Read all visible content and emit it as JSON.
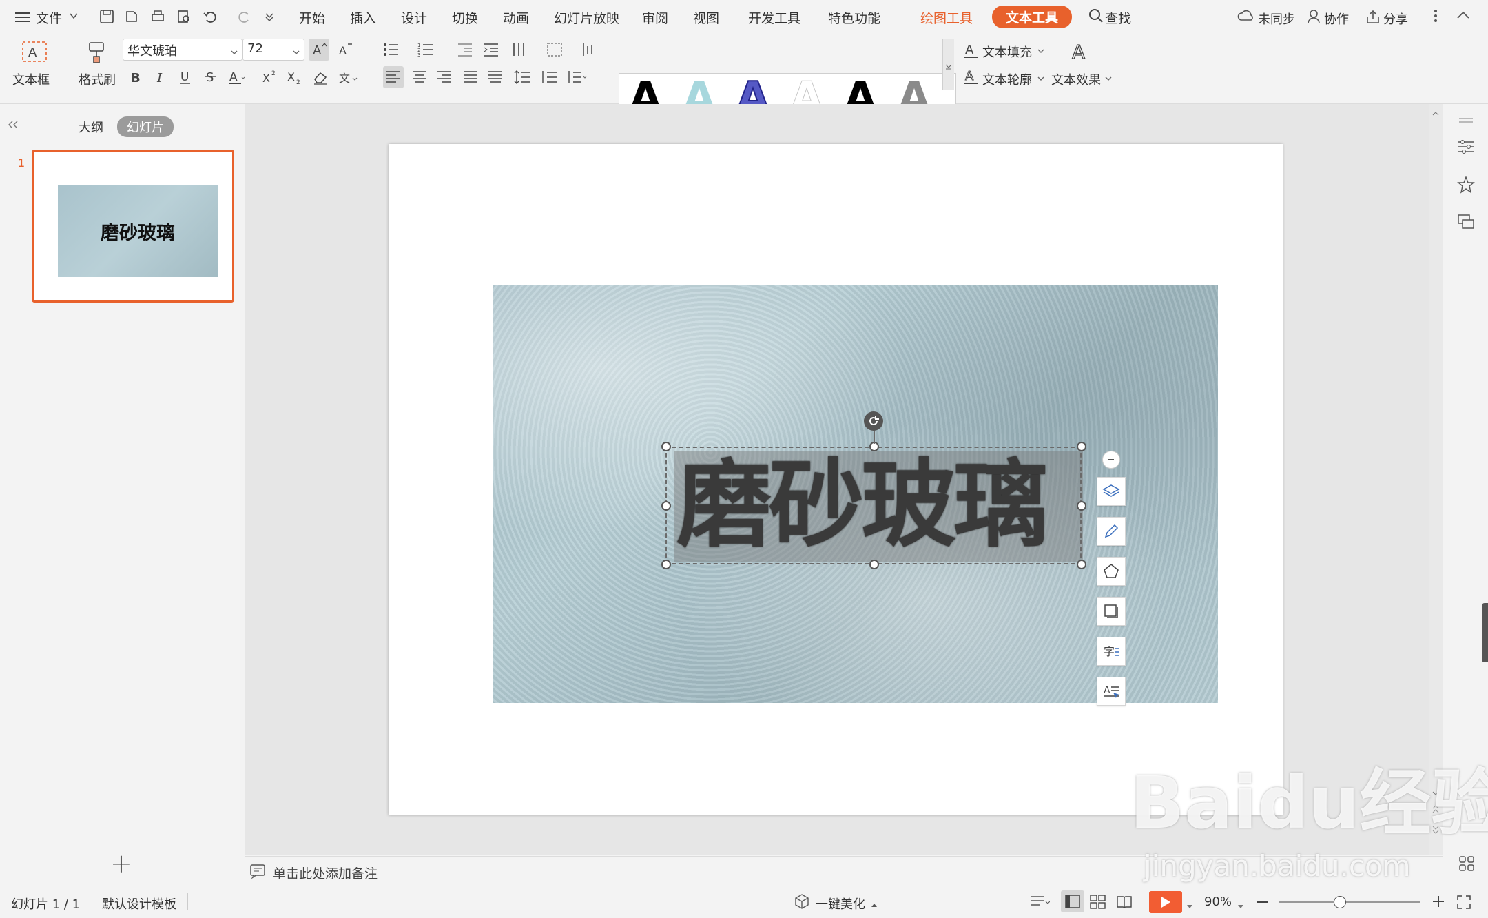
{
  "menubar": {
    "file_label": "文件",
    "tabs": [
      "开始",
      "插入",
      "设计",
      "切换",
      "动画",
      "幻灯片放映",
      "审阅",
      "视图",
      "开发工具",
      "特色功能"
    ],
    "context_tabs": {
      "drawing_tools": "绘图工具",
      "text_tools": "文本工具"
    },
    "search_label": "查找",
    "right": {
      "sync": "未同步",
      "collab": "协作",
      "share": "分享"
    }
  },
  "ribbon": {
    "textbox_label": "文本框",
    "format_painter_label": "格式刷",
    "font_name": "华文琥珀",
    "font_size": "72",
    "text_fill_label": "文本填充",
    "text_outline_label": "文本轮廓",
    "text_effect_label": "文本效果",
    "style_glyph": "A"
  },
  "leftpane": {
    "tab_outline": "大纲",
    "tab_slides": "幻灯片",
    "slide_number": "1",
    "thumbnail_text": "磨砂玻璃",
    "add_symbol": "+"
  },
  "slide": {
    "art_text": "磨砂玻璃"
  },
  "notes": {
    "placeholder": "单击此处添加备注"
  },
  "status": {
    "slide_count": "幻灯片 1 / 1",
    "template": "默认设计模板",
    "beautify": "一键美化",
    "zoom": "90%"
  },
  "watermark": {
    "logo": "Baidu经验",
    "url": "jingyan.baidu.com"
  },
  "colors": {
    "accent": "#e8612c",
    "selection_border": "#6a6a6a"
  }
}
